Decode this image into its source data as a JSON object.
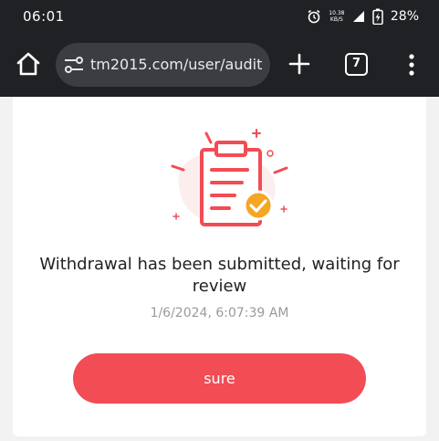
{
  "status_bar": {
    "time": "06:01",
    "net_speed_value": "10.38",
    "net_speed_unit": "KB/S",
    "battery": "28%"
  },
  "browser": {
    "url": "tm2015.com/user/audit",
    "tab_count": "7",
    "icons": [
      "home-icon",
      "site-info-icon",
      "plus-icon",
      "tab-switcher-icon",
      "more-vert-icon"
    ]
  },
  "dialog": {
    "message": "Withdrawal has been submitted, waiting for review",
    "timestamp": "1/6/2024, 6:07:39 AM",
    "button_label": "sure"
  },
  "colors": {
    "accent": "#f24c55",
    "check_badge": "#f5a623",
    "toolbar_bg": "#202124"
  }
}
